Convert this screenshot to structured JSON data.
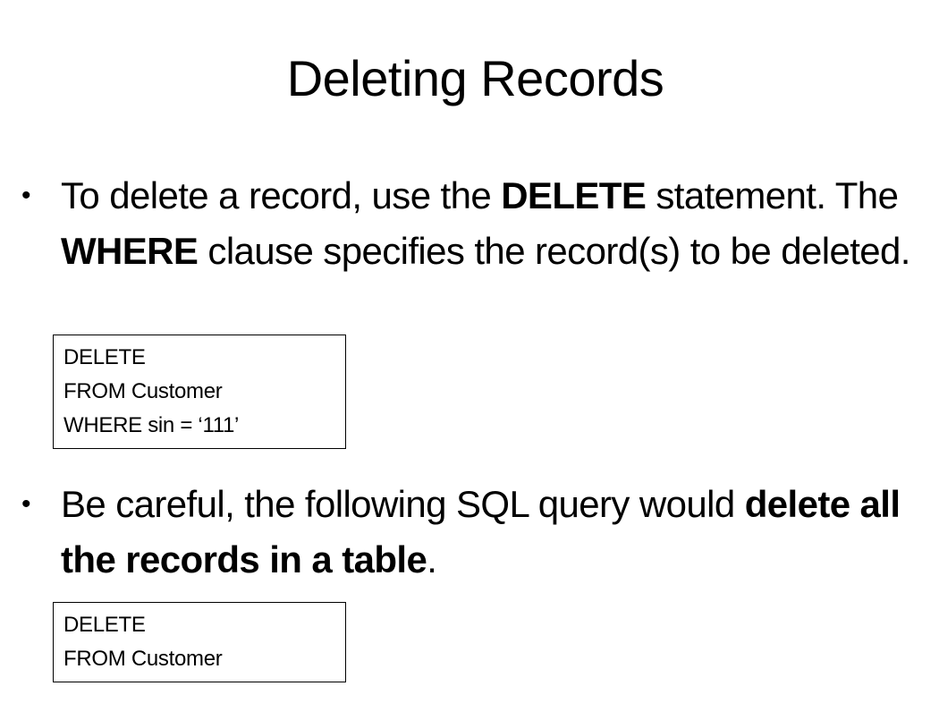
{
  "slide": {
    "title": "Deleting Records",
    "bullets": [
      {
        "parts": [
          {
            "text": "To delete a record, use the ",
            "bold": false
          },
          {
            "text": "DELETE",
            "bold": true
          },
          {
            "text": " statement. The ",
            "bold": false
          },
          {
            "text": "WHERE",
            "bold": true
          },
          {
            "text": " clause specifies the record(s) to be deleted.",
            "bold": false
          }
        ],
        "code": [
          "DELETE",
          "FROM Customer",
          "WHERE sin = ‘111’"
        ]
      },
      {
        "parts": [
          {
            "text": "Be careful, the following SQL query would ",
            "bold": false
          },
          {
            "text": "delete all the records in a table",
            "bold": true
          },
          {
            "text": ".",
            "bold": false
          }
        ],
        "code": [
          "DELETE",
          "FROM Customer"
        ]
      }
    ],
    "bullet_symbol": "•"
  }
}
